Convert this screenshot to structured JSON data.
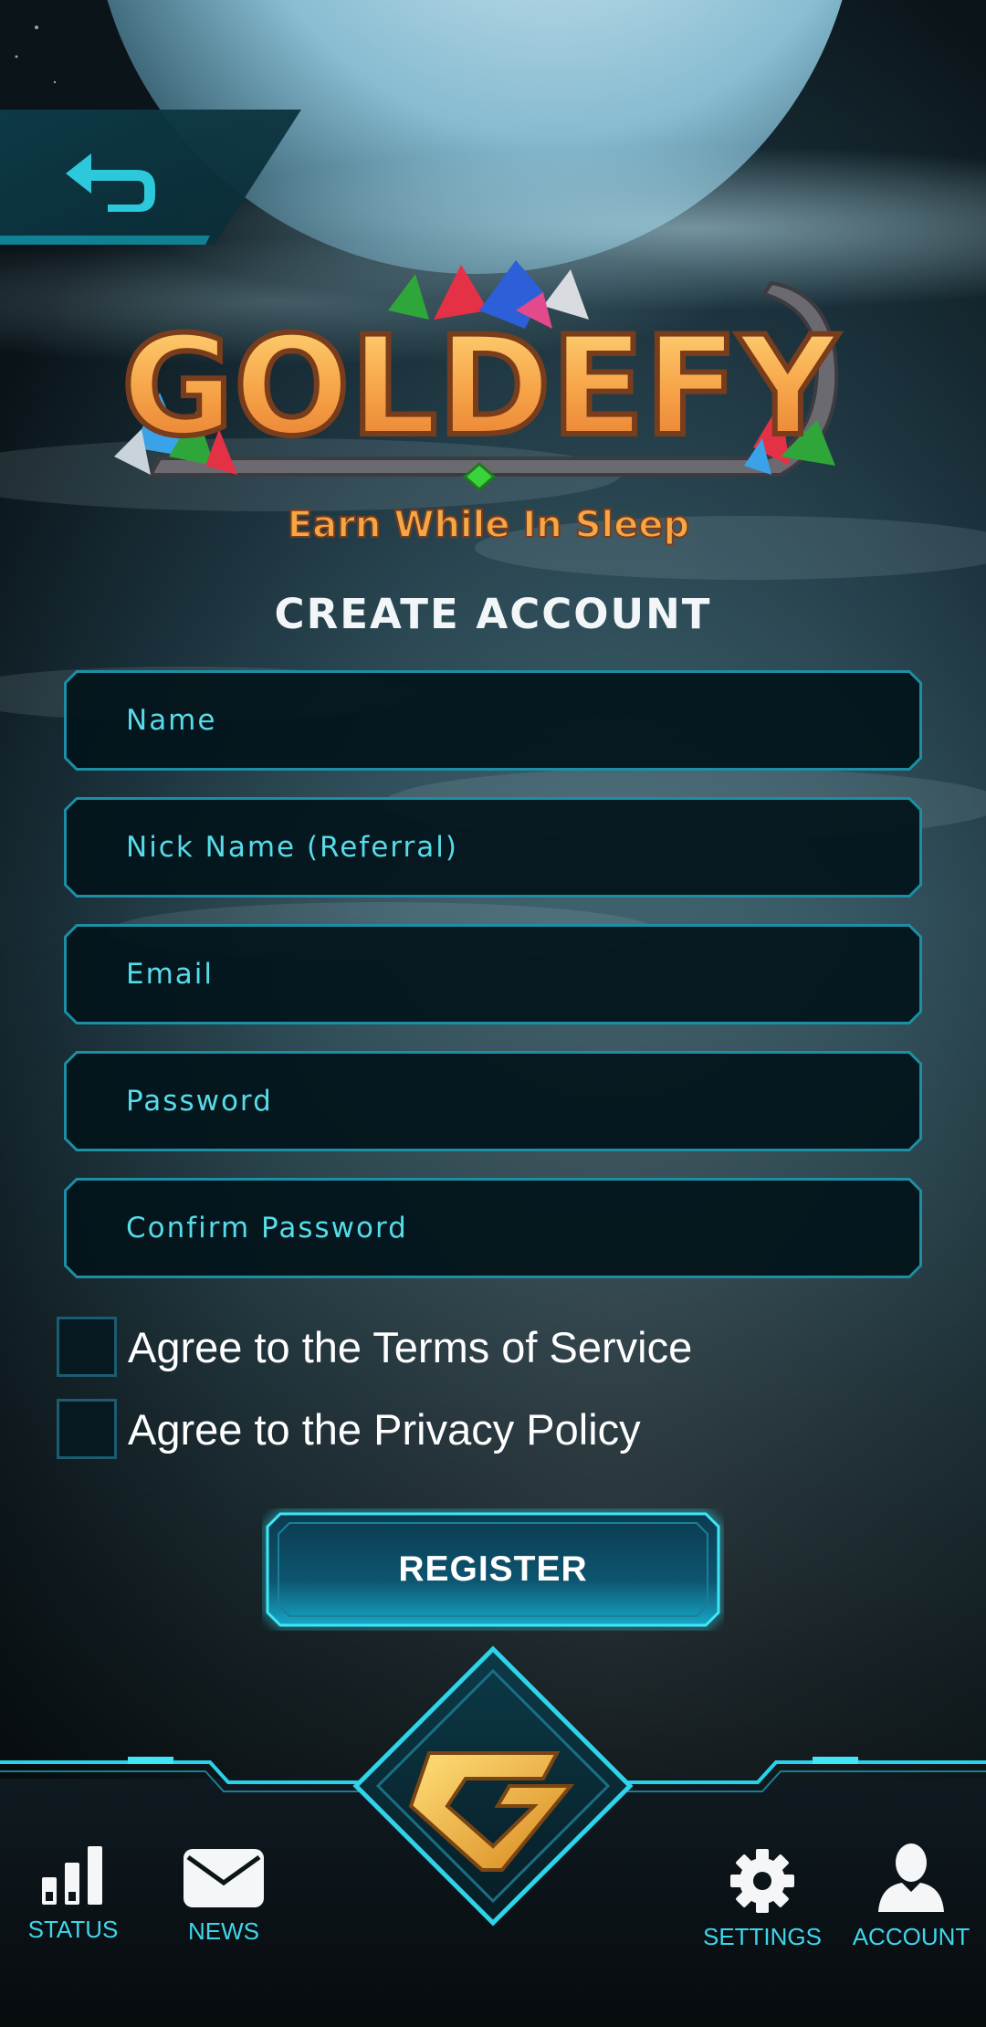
{
  "app": {
    "logo_title": "GOLDEFY",
    "logo_tagline": "Earn While In Sleep"
  },
  "page_title": "CREATE ACCOUNT",
  "form": {
    "fields": [
      {
        "placeholder": "Name",
        "value": ""
      },
      {
        "placeholder": "Nick Name (Referral)",
        "value": ""
      },
      {
        "placeholder": "Email",
        "value": ""
      },
      {
        "placeholder": "Password",
        "value": ""
      },
      {
        "placeholder": "Confirm Password",
        "value": ""
      }
    ],
    "checkboxes": [
      {
        "label": "Agree to the Terms of Service",
        "checked": false
      },
      {
        "label": "Agree to the Privacy Policy",
        "checked": false
      }
    ],
    "submit_label": "REGISTER"
  },
  "icons": {
    "back": "back-arrow-icon",
    "status": "bar-chart-icon",
    "news": "envelope-icon",
    "home": "goldefy-g-emblem-icon",
    "settings": "gear-icon",
    "account": "user-icon"
  },
  "nav": {
    "status_label": "STATUS",
    "news_label": "NEWS",
    "settings_label": "SETTINGS",
    "account_label": "ACCOUNT"
  },
  "colors": {
    "accent": "#2fd3ea",
    "text_field": "#57dbe8",
    "logo_gold": "#f7a64a"
  }
}
